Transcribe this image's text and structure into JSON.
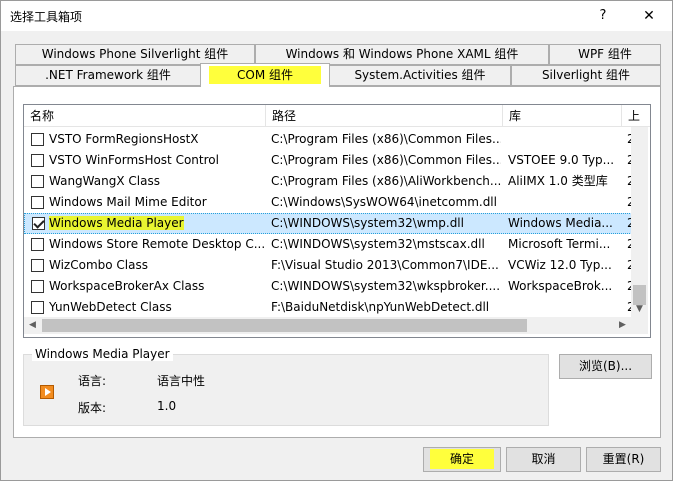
{
  "window": {
    "title": "选择工具箱项",
    "help_label": "?",
    "close_label": "✕"
  },
  "tabs": {
    "row1": [
      "Windows Phone Silverlight 组件",
      "Windows 和 Windows Phone XAML 组件",
      "WPF 组件"
    ],
    "row2": [
      ".NET Framework 组件",
      "COM 组件",
      "System.Activities 组件",
      "Silverlight 组件"
    ],
    "active": "COM 组件"
  },
  "list": {
    "columns": [
      "名称",
      "路径",
      "库",
      "上"
    ],
    "rows": [
      {
        "checked": false,
        "name": "VSTO FormRegionsHostX",
        "path": "C:\\Program Files (x86)\\Common Files...",
        "library": "",
        "extra": "2"
      },
      {
        "checked": false,
        "name": "VSTO WinFormsHost Control",
        "path": "C:\\Program Files (x86)\\Common Files...",
        "library": "VSTOEE 9.0 Typ...",
        "extra": "2"
      },
      {
        "checked": false,
        "name": "WangWangX Class",
        "path": "C:\\Program Files (x86)\\AliWorkbench...",
        "library": "AliIMX 1.0 类型库",
        "extra": "2"
      },
      {
        "checked": false,
        "name": "Windows Mail Mime Editor",
        "path": "C:\\Windows\\SysWOW64\\inetcomm.dll",
        "library": "",
        "extra": "2"
      },
      {
        "checked": true,
        "name": "Windows Media Player",
        "path": "C:\\WINDOWS\\system32\\wmp.dll",
        "library": "Windows Media...",
        "extra": "2",
        "selected": true
      },
      {
        "checked": false,
        "name": "Windows Store Remote Desktop C...",
        "path": "C:\\WINDOWS\\system32\\mstscax.dll",
        "library": "Microsoft Termi...",
        "extra": "2"
      },
      {
        "checked": false,
        "name": "WizCombo Class",
        "path": "F:\\Visual Studio 2013\\Common7\\IDE...",
        "library": "VCWiz 12.0 Typ...",
        "extra": "2"
      },
      {
        "checked": false,
        "name": "WorkspaceBrokerAx Class",
        "path": "C:\\WINDOWS\\system32\\wkspbroker....",
        "library": "WorkspaceBrok...",
        "extra": "2"
      },
      {
        "checked": false,
        "name": "YunWebDetect Class",
        "path": "F:\\BaiduNetdisk\\npYunWebDetect.dll",
        "library": "",
        "extra": "2"
      }
    ]
  },
  "details": {
    "title": "Windows Media Player",
    "language_label": "语言:",
    "language_value": "语言中性",
    "version_label": "版本:",
    "version_value": "1.0"
  },
  "buttons": {
    "browse": "浏览(B)...",
    "ok": "确定",
    "cancel": "取消",
    "reset": "重置(R)"
  },
  "colors": {
    "highlight": "#ffff3c",
    "selection": "#cce8ff"
  }
}
